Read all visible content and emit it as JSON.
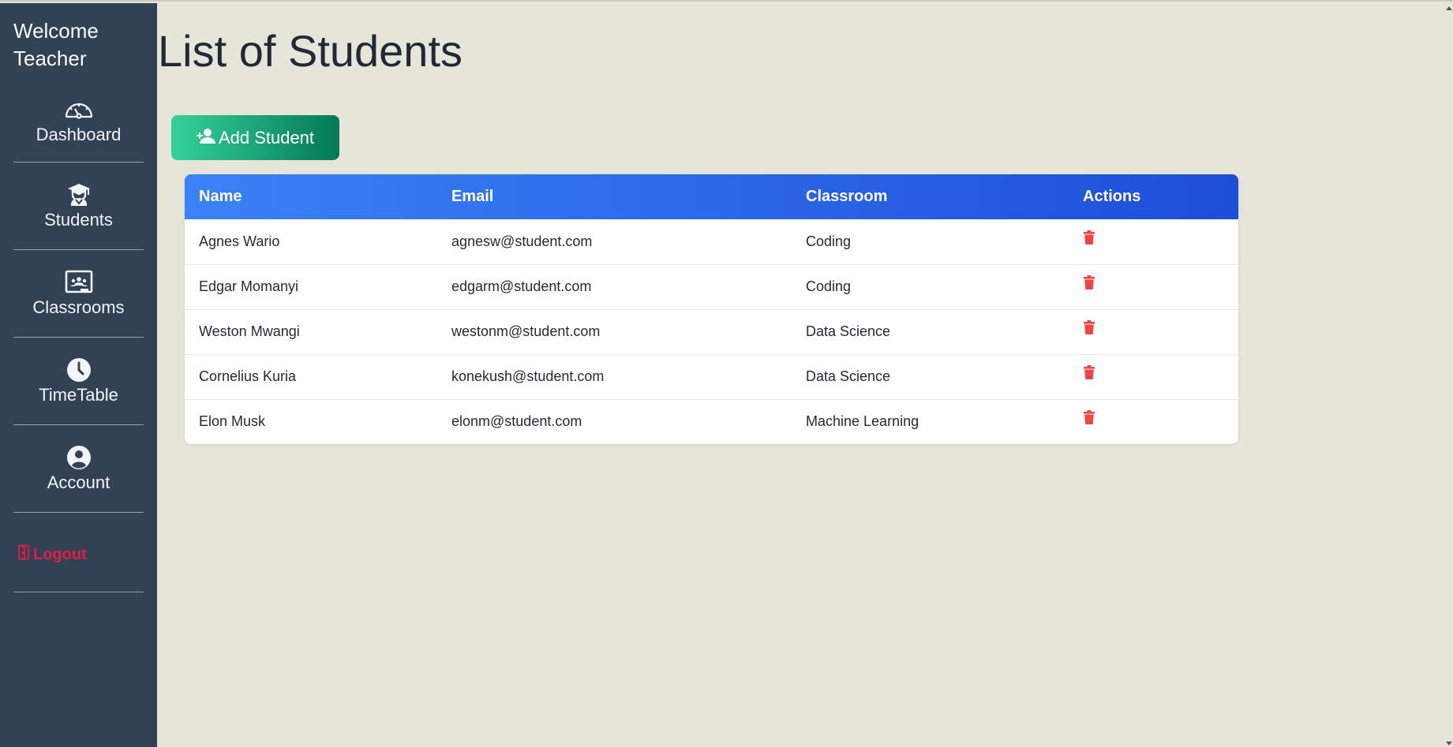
{
  "sidebar": {
    "title": "Welcome Teacher",
    "items": [
      {
        "label": "Dashboard",
        "icon": "dashboard-gauge-icon"
      },
      {
        "label": "Students",
        "icon": "student-graduate-icon"
      },
      {
        "label": "Classrooms",
        "icon": "classroom-board-icon"
      },
      {
        "label": "TimeTable",
        "icon": "clock-icon"
      },
      {
        "label": "Account",
        "icon": "user-circle-icon"
      }
    ],
    "logout_label": "Logout"
  },
  "main": {
    "title": "List of Students",
    "add_button_label": "Add Student"
  },
  "table": {
    "columns": [
      "Name",
      "Email",
      "Classroom",
      "Actions"
    ],
    "rows": [
      {
        "name": "Agnes Wario",
        "email": "agnesw@student.com",
        "classroom": "Coding"
      },
      {
        "name": "Edgar Momanyi",
        "email": "edgarm@student.com",
        "classroom": "Coding"
      },
      {
        "name": "Weston Mwangi",
        "email": "westonm@student.com",
        "classroom": "Data Science"
      },
      {
        "name": "Cornelius Kuria",
        "email": "konekush@student.com",
        "classroom": "Data Science"
      },
      {
        "name": "Elon Musk",
        "email": "elonm@student.com",
        "classroom": "Machine Learning"
      }
    ]
  },
  "colors": {
    "sidebar_bg": "#334155",
    "page_bg": "#e5e6d8",
    "logout": "#e11d48",
    "delete_icon": "#ef4444",
    "header_gradient": [
      "#3b82f6",
      "#1d4ed8"
    ],
    "button_gradient": [
      "#34d399",
      "#047857"
    ]
  }
}
